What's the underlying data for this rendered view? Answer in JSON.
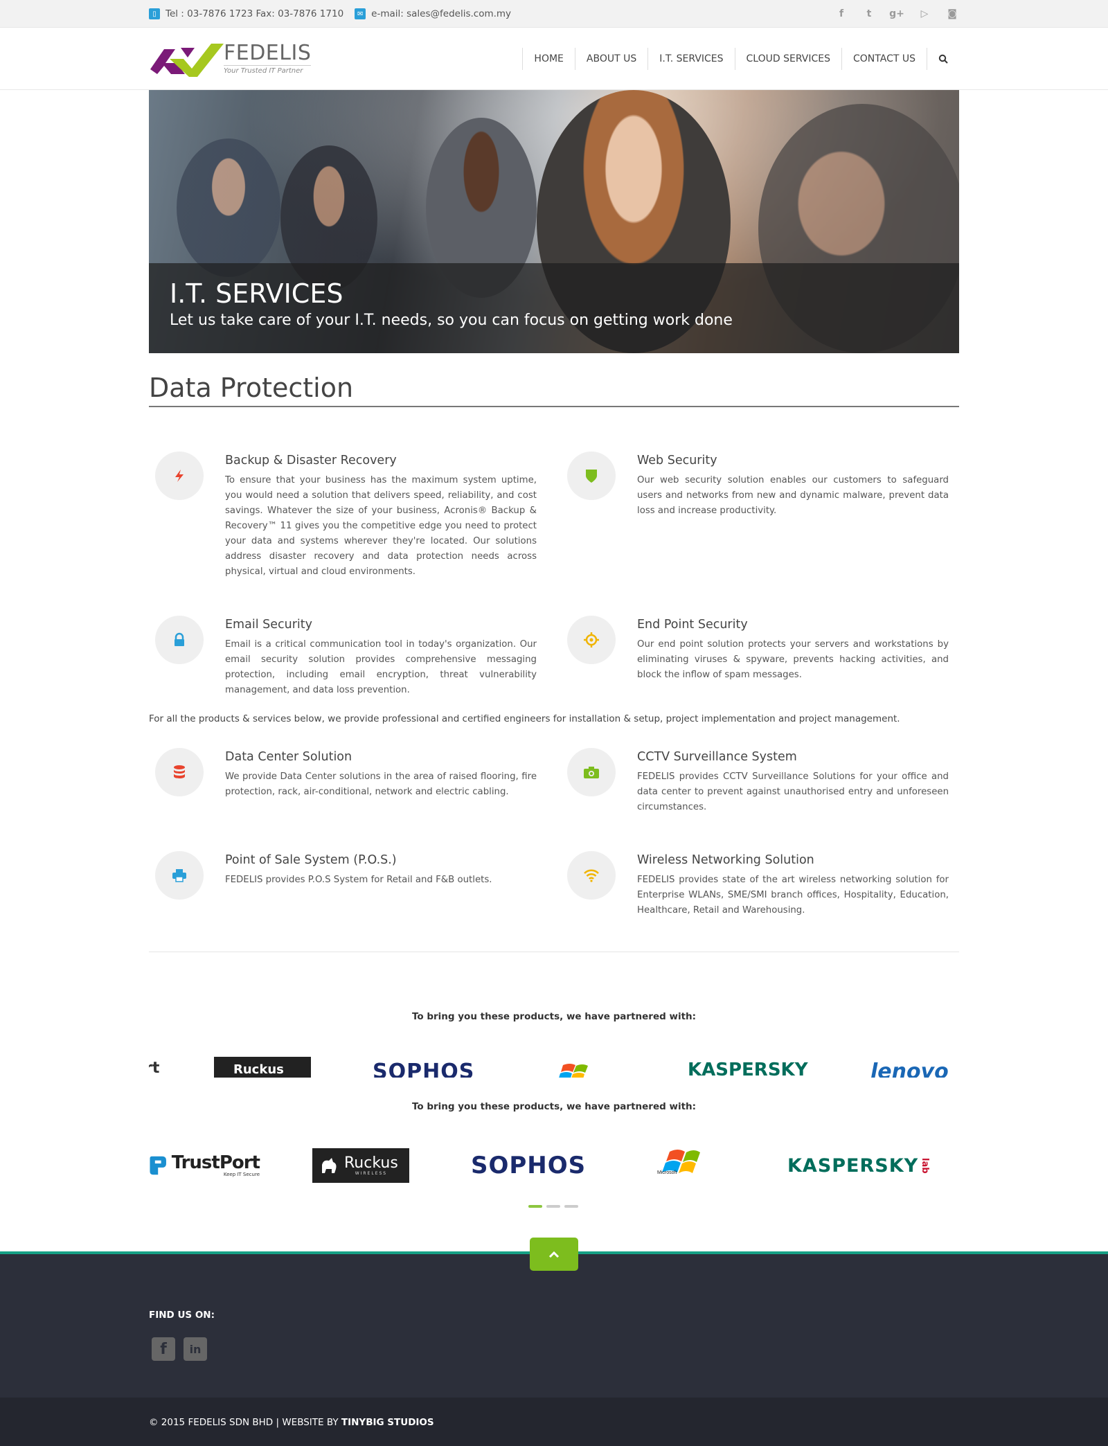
{
  "topbar": {
    "phone_text": "Tel : 03-7876 1723 Fax: 03-7876 1710",
    "email_text": "e-mail: sales@fedelis.com.my",
    "social": [
      "facebook-icon",
      "twitter-icon",
      "google-plus-icon",
      "youtube-icon",
      "instagram-icon"
    ]
  },
  "brand": {
    "name": "FEDELIS",
    "tagline": "Your Trusted IT Partner",
    "colors": {
      "purple": "#7b1a78",
      "green": "#a6c81f"
    }
  },
  "nav": {
    "items": [
      "HOME",
      "ABOUT US",
      "I.T. SERVICES",
      "CLOUD SERVICES",
      "CONTACT US"
    ]
  },
  "hero": {
    "title": "I.T. SERVICES",
    "subtitle": "Let us take care of your I.T. needs, so you can focus on getting work done"
  },
  "section": {
    "title": "Data Protection"
  },
  "services": [
    {
      "title": "Backup & Disaster Recovery",
      "icon": "bolt-icon",
      "text": "To ensure that your business has the maximum system uptime, you would need a solution that delivers speed, reliability, and cost savings. Whatever the size of your business, Acronis® Backup & Recovery™ 11 gives you the competitive edge you need to protect your data and systems wherever they're located. Our solutions address disaster recovery and data protection needs across physical, virtual and cloud environments."
    },
    {
      "title": "Web Security",
      "icon": "shield-icon",
      "text": "Our web security solution enables our customers to safeguard users and networks from new and dynamic malware, prevent data loss and increase productivity."
    },
    {
      "title": "Email Security",
      "icon": "lock-icon",
      "text": "Email is a critical communication tool in today's organization. Our email security solution provides comprehensive messaging protection, including email encryption, threat vulnerability management, and data loss prevention."
    },
    {
      "title": "End Point Security",
      "icon": "crosshair-icon",
      "text": "Our end point solution protects your servers and workstations by eliminating viruses & spyware, prevents hacking activities, and block the inflow of spam messages."
    },
    {
      "title": "Data Center Solution",
      "icon": "database-icon",
      "text": "We provide Data Center solutions in the area of raised flooring, fire protection, rack, air-conditional, network and electric cabling."
    },
    {
      "title": "CCTV Surveillance System",
      "icon": "camera-icon",
      "text": "FEDELIS provides CCTV Surveillance Solutions for your office and data center to prevent against unauthorised entry and unforeseen circumstances."
    },
    {
      "title": "Point of Sale System (P.O.S.)",
      "icon": "printer-icon",
      "text": "FEDELIS provides P.O.S System for Retail and F&B outlets."
    },
    {
      "title": "Wireless Networking Solution",
      "icon": "wifi-icon",
      "text": "FEDELIS provides state of the art wireless networking solution for Enterprise WLANs, SME/SMI branch offices, Hospitality, Education, Healthcare, Retail and Warehousing."
    }
  ],
  "note": "For all the products & services below, we provide professional and certified engineers for installation & setup, project implementation and project management.",
  "partners": {
    "title": "To bring you these products, we have partnered with:",
    "strip": [
      "rt",
      "Ruckus",
      "SOPHOS",
      "KASPERSKY",
      "lenovo"
    ],
    "logos": {
      "trustport": "TrustPort",
      "trustport_tag": "Keep IT Secure",
      "ruckus": "Ruckus",
      "ruckus_tag": "WIRELESS",
      "sophos": "SOPHOS",
      "microsoft": "Microsoft",
      "kaspersky": "KASPERSKY",
      "kaspersky_tag": "lab"
    },
    "page_count": 3,
    "active_page": 1
  },
  "footer": {
    "find_label": "FIND US ON:",
    "social": [
      "facebook-icon",
      "linkedin-icon"
    ],
    "copyright": "© 2015 FEDELIS SDN BHD | WEBSITE BY ",
    "studio": "TINYBIG STUDIOS"
  }
}
